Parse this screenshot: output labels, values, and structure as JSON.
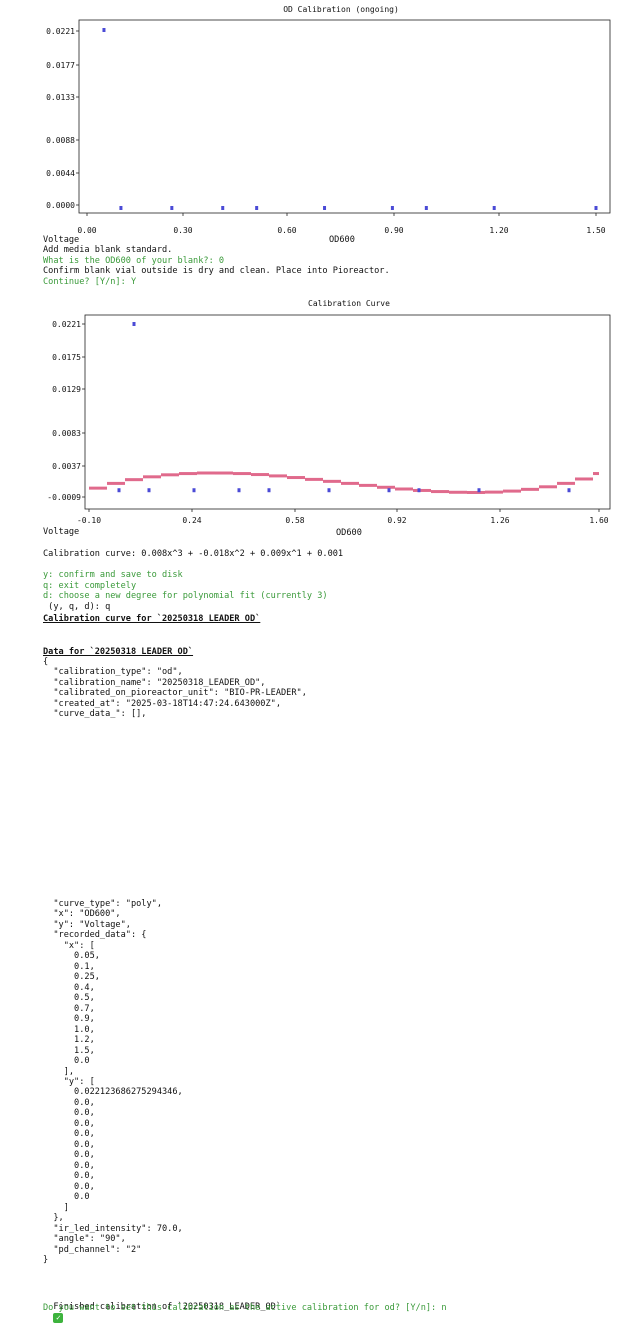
{
  "chart1": {
    "title": "OD Calibration (ongoing)",
    "yticks": [
      "0.0221",
      "0.0177",
      "0.0133",
      "0.0088",
      "0.0044",
      "0.0000"
    ],
    "xticks": [
      "0.00",
      "0.30",
      "0.60",
      "0.90",
      "1.20",
      "1.50"
    ],
    "ylabel": "Voltage",
    "xlabel": "OD600"
  },
  "chart_data": [
    {
      "type": "scatter",
      "title": "OD Calibration (ongoing)",
      "xlabel": "OD600",
      "ylabel": "Voltage",
      "xlim": [
        0.0,
        1.52
      ],
      "ylim": [
        0.0,
        0.0221
      ],
      "series": [
        {
          "x": [
            0.05,
            0.1,
            0.25,
            0.4,
            0.5,
            0.7,
            0.9,
            1.0,
            1.2,
            1.5
          ],
          "y": [
            0.0221,
            0.0,
            0.0,
            0.0,
            0.0,
            0.0,
            0.0,
            0.0,
            0.0,
            0.0
          ]
        }
      ]
    },
    {
      "type": "scatter",
      "title": "Calibration Curve",
      "xlabel": "OD600",
      "ylabel": "Voltage",
      "xlim": [
        -0.1,
        1.6
      ],
      "ylim": [
        -0.0009,
        0.0221
      ],
      "series": [
        {
          "x": [
            0.05,
            0.1,
            0.25,
            0.4,
            0.5,
            0.7,
            0.9,
            1.0,
            1.2,
            1.5,
            0.0
          ],
          "y": [
            0.0221,
            0.0,
            0.0,
            0.0,
            0.0,
            0.0,
            0.0,
            0.0,
            0.0,
            0.0,
            0.0
          ]
        }
      ],
      "fit_curve": "0.008x^3 + -0.018x^2 + 0.009x^1 + 0.001"
    }
  ],
  "chart2": {
    "title": "Calibration Curve",
    "yticks": [
      "0.0221",
      "0.0175",
      "0.0129",
      "0.0083",
      "0.0037",
      "-0.0009"
    ],
    "xticks": [
      "-0.10",
      "0.24",
      "0.58",
      "0.92",
      "1.26",
      "1.60"
    ],
    "ylabel": "Voltage",
    "xlabel": "OD600"
  },
  "colors": {
    "point": "#4a4ad6",
    "fit": "#e06a8c",
    "green": "#3a9a3a"
  },
  "terminal": {
    "l1": "Add media blank standard.",
    "l2": "What is the OD600 of your blank?: 0",
    "l3": "Confirm blank vial outside is dry and clean. Place into Pioreactor.",
    "l4": "Continue? [Y/n]: Y",
    "curve_eq": "Calibration curve: 0.008x^3 + -0.018x^2 + 0.009x^1 + 0.001",
    "opt_y": "y: confirm and save to disk",
    "opt_q": "q: exit completely",
    "opt_d": "d: choose a new degree for polynomial fit (currently 3)",
    "prompt": " (y, q, d): q",
    "cal_header": "Calibration curve for `20250318_LEADER_OD`",
    "data_header": "Data for `20250318_LEADER_OD`",
    "json_top": [
      "{",
      "  \"calibration_type\": \"od\",",
      "  \"calibration_name\": \"20250318_LEADER_OD\",",
      "  \"calibrated_on_pioreactor_unit\": \"BIO-PR-LEADER\",",
      "  \"created_at\": \"2025-03-18T14:47:24.643000Z\",",
      "  \"curve_data_\": [],"
    ],
    "json_bottom": [
      "  \"curve_type\": \"poly\",",
      "  \"x\": \"OD600\",",
      "  \"y\": \"Voltage\",",
      "  \"recorded_data\": {",
      "    \"x\": [",
      "      0.05,",
      "      0.1,",
      "      0.25,",
      "      0.4,",
      "      0.5,",
      "      0.7,",
      "      0.9,",
      "      1.0,",
      "      1.2,",
      "      1.5,",
      "      0.0",
      "    ],",
      "    \"y\": [",
      "      0.022123686275294346,",
      "      0.0,",
      "      0.0,",
      "      0.0,",
      "      0.0,",
      "      0.0,",
      "      0.0,",
      "      0.0,",
      "      0.0,",
      "      0.0,",
      "      0.0",
      "    ]",
      "  },",
      "  \"ir_led_intensity\": 70.0,",
      "  \"angle\": \"90\",",
      "  \"pd_channel\": \"2\"",
      "}"
    ],
    "finished": "Finished calibration of `20250318_LEADER_OD`",
    "active_q": "Do you want to set this calibration as the active calibration for od? [Y/n]: n"
  }
}
